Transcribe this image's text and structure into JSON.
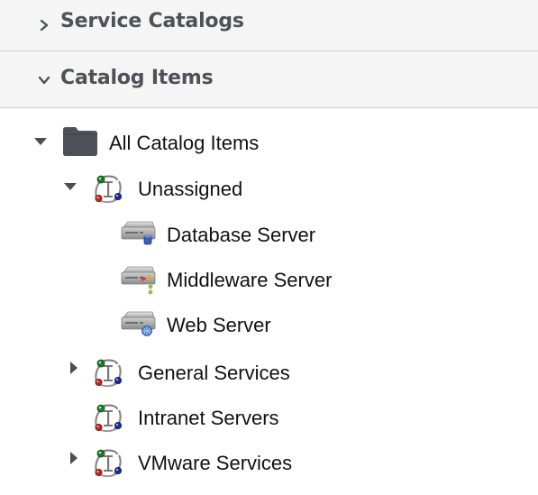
{
  "accordion": {
    "service_catalogs": {
      "title": "Service Catalogs",
      "expanded": false
    },
    "catalog_items": {
      "title": "Catalog Items",
      "expanded": true
    }
  },
  "tree": {
    "root": {
      "label": "All Catalog Items",
      "icon": "folder-icon",
      "expanded": true
    },
    "unassigned": {
      "label": "Unassigned",
      "icon": "catalog-icon",
      "expanded": true
    },
    "database_server": {
      "label": "Database Server",
      "icon": "database-server-icon"
    },
    "middleware_server": {
      "label": "Middleware Server",
      "icon": "middleware-server-icon"
    },
    "web_server": {
      "label": "Web Server",
      "icon": "web-server-icon"
    },
    "general_services": {
      "label": "General Services",
      "icon": "catalog-icon",
      "expanded": false
    },
    "intranet_servers": {
      "label": "Intranet Servers",
      "icon": "catalog-icon"
    },
    "vmware_services": {
      "label": "VMware Services",
      "icon": "catalog-icon",
      "expanded": false
    }
  },
  "colors": {
    "header_bg": "#f5f5f5",
    "header_text": "#4d5258",
    "border": "#d1d1d1",
    "folder": "#4d5258"
  }
}
